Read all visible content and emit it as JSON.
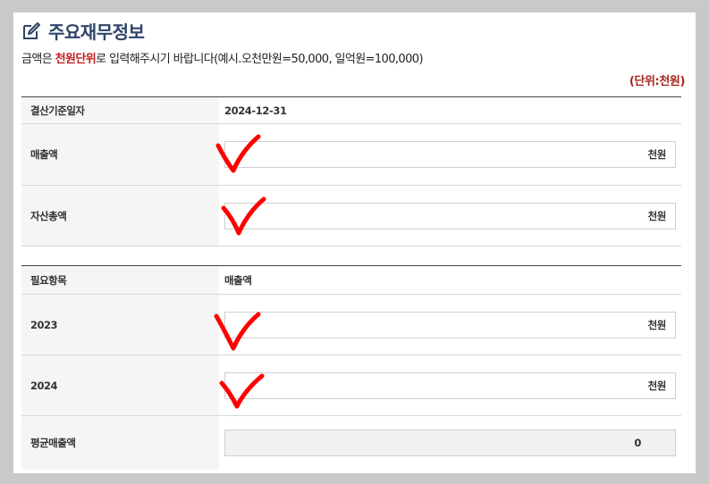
{
  "header": {
    "title": "주요재무정보",
    "icon": "edit-icon"
  },
  "notice": {
    "prefix": "금액은 ",
    "emphasis": "천원단위",
    "suffix": "로 입력해주시기 바랍니다(예시.오천만원=50,000, 일억원=100,000)"
  },
  "unit_note": "(단위:천원)",
  "basic_table": {
    "settlement_date_label": "결산기준일자",
    "settlement_date_value": "2024-12-31",
    "revenue_label": "매출액",
    "revenue_unit": "천원",
    "total_assets_label": "자산총액",
    "total_assets_unit": "천원"
  },
  "required_table": {
    "item_label": "필요항목",
    "item_value": "매출액",
    "year1_label": "2023",
    "year1_unit": "천원",
    "year2_label": "2024",
    "year2_unit": "천원",
    "average_label": "평균매출액",
    "average_value": "0"
  },
  "colors": {
    "title": "#2f4467",
    "emphasis": "#c0201e",
    "unit_note": "#a6271c",
    "annotation": "#ff0000"
  }
}
